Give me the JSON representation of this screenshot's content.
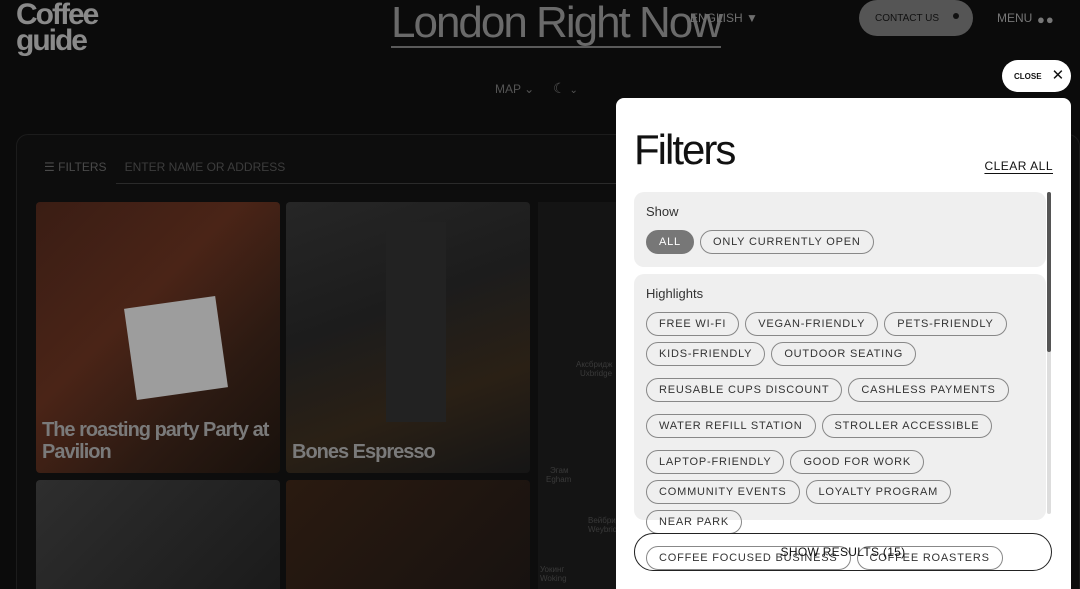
{
  "header": {
    "logo_line1": "Coffee",
    "logo_line2": "guide",
    "title": "London Right Now",
    "language": "ENGLISH",
    "contact_label": "CONTACT US",
    "menu_label": "MENU"
  },
  "toolbar": {
    "map_label": "MAP"
  },
  "list": {
    "filters_label": "FILTERS",
    "search_placeholder": "ENTER NAME OR ADDRESS",
    "cards": [
      {
        "name_line1": "The roasting party Party at",
        "name_line2": "Pavilion"
      },
      {
        "name_line1": "Bones Espresso"
      }
    ]
  },
  "map": {
    "labels": [
      "Аксбридж",
      "Uxbridge",
      "Эгам",
      "Egham",
      "Вейбридж",
      "Weybridge",
      "Уокинг",
      "Woking"
    ]
  },
  "modal": {
    "close_label": "CLOSE",
    "title": "Filters",
    "clear_all": "CLEAR ALL",
    "show_section": {
      "label": "Show",
      "options": [
        {
          "label": "ALL",
          "selected": true
        },
        {
          "label": "ONLY CURRENTLY OPEN",
          "selected": false
        }
      ]
    },
    "highlights_section": {
      "label": "Highlights",
      "options": [
        "FREE WI-FI",
        "VEGAN-FRIENDLY",
        "PETS-FRIENDLY",
        "KIDS-FRIENDLY",
        "OUTDOOR SEATING",
        "REUSABLE CUPS DISCOUNT",
        "CASHLESS PAYMENTS",
        "WATER REFILL STATION",
        "STROLLER ACCESSIBLE",
        "LAPTOP-FRIENDLY",
        "GOOD FOR WORK",
        "COMMUNITY EVENTS",
        "LOYALTY PROGRAM",
        "NEAR PARK",
        "COFFEE FOCUSED BUSINESS",
        "COFFEE ROASTERS"
      ]
    },
    "show_results": "SHOW RESULTS (15)"
  },
  "colors": {
    "overlay_bg": "#0b0b0b",
    "modal_bg": "#ffffff",
    "section_bg": "#efefef",
    "selected_chip": "#777777"
  }
}
